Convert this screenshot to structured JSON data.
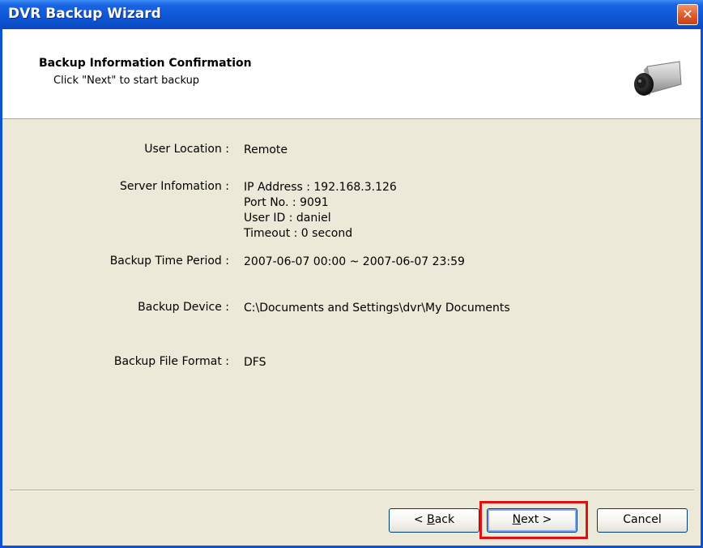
{
  "window": {
    "title": "DVR Backup Wizard",
    "close_label": "✕"
  },
  "header": {
    "title": "Backup Information Confirmation",
    "subtitle": "Click \"Next\" to start backup"
  },
  "info": {
    "user_location_label": "User Location :",
    "user_location_value": "Remote",
    "server_info_label": "Server Infomation :",
    "server_ip": "IP Address : 192.168.3.126",
    "server_port": "Port No. : 9091",
    "server_user": "User ID : daniel",
    "server_timeout": "Timeout : 0 second",
    "time_period_label": "Backup Time Period :",
    "time_period_value": "2007-06-07 00:00 ~ 2007-06-07 23:59",
    "device_label": "Backup Device :",
    "device_value": "C:\\Documents and Settings\\dvr\\My Documents",
    "format_label": "Backup File Format :",
    "format_value": "DFS"
  },
  "buttons": {
    "back_prefix": "< ",
    "back_mnemonic": "B",
    "back_rest": "ack",
    "next_mnemonic": "N",
    "next_rest": "ext >",
    "cancel": "Cancel"
  },
  "colors": {
    "titlebar": "#0c4ec8",
    "dialog_bg": "#ece9d8",
    "highlight": "#e01010"
  }
}
